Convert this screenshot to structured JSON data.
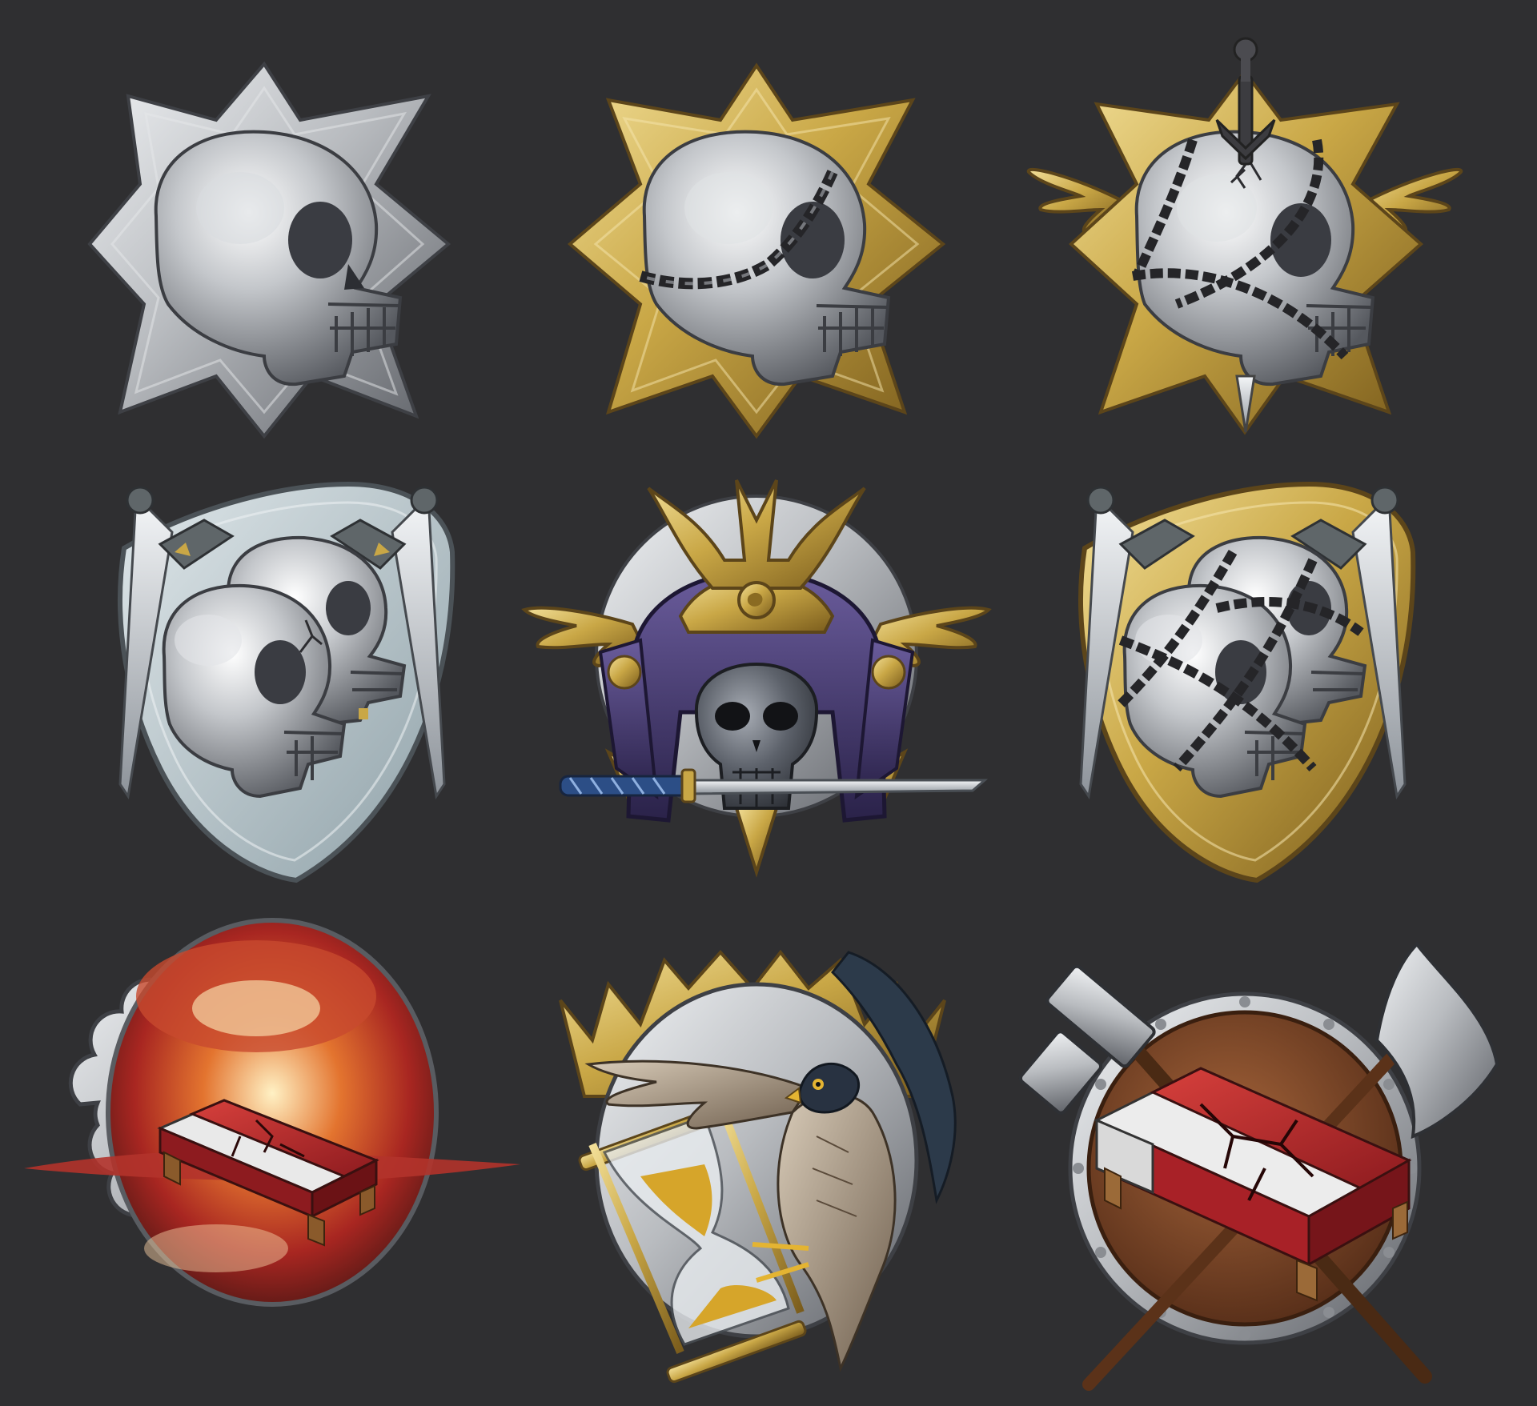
{
  "background": "#2f2f31",
  "palette": {
    "silver": "#b9bcc0",
    "silver_dark": "#6e7177",
    "silver_light": "#e9ebee",
    "gold": "#c9a746",
    "gold_dark": "#8a6b22",
    "gold_light": "#ead488",
    "steel_blue": "#b8c6cc",
    "chain": "#2a2a2c",
    "purple": "#3f3566",
    "purple_light": "#6a5c9c",
    "red": "#b3262a",
    "wood": "#7a4a22",
    "fire": "#c0432a"
  },
  "badges": [
    {
      "icon": "skull-spiked-silver-star-icon",
      "frame": "silver"
    },
    {
      "icon": "skull-chained-gold-star-icon",
      "frame": "gold"
    },
    {
      "icon": "skull-chained-winged-sword-icon",
      "frame": "gold"
    },
    {
      "icon": "twin-skulls-silver-shield-icon",
      "frame": "silver"
    },
    {
      "icon": "samurai-helmet-skull-katana-icon",
      "frame": "gold"
    },
    {
      "icon": "twin-skulls-chained-gold-shield-icon",
      "frame": "gold"
    },
    {
      "icon": "broken-bed-explosion-icon",
      "frame": "silver"
    },
    {
      "icon": "falcon-hourglass-crown-icon",
      "frame": "gold"
    },
    {
      "icon": "broken-bed-hammer-axe-shield-icon",
      "frame": "wood"
    }
  ]
}
